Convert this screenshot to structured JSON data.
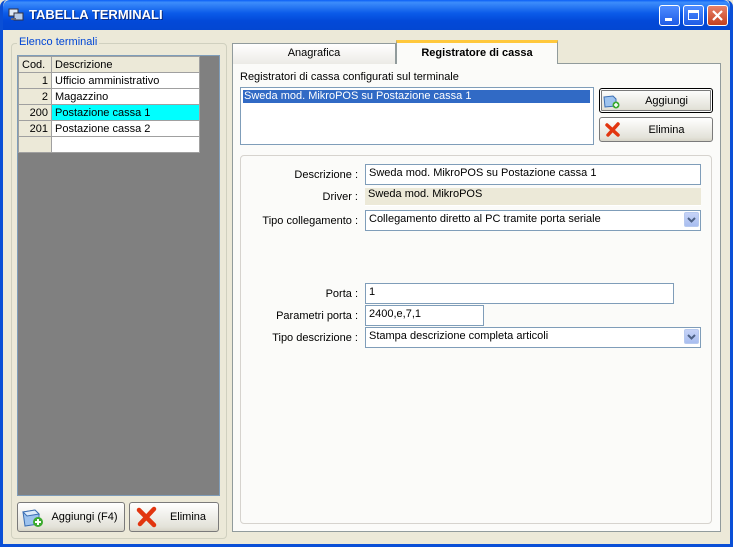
{
  "window": {
    "title": "TABELLA TERMINALI"
  },
  "left": {
    "group_label": "Elenco terminali",
    "columns": [
      "Cod.",
      "Descrizione"
    ],
    "rows": [
      {
        "code": "1",
        "desc": "Ufficio amministrativo"
      },
      {
        "code": "2",
        "desc": "Magazzino"
      },
      {
        "code": "200",
        "desc": "Postazione cassa 1"
      },
      {
        "code": "201",
        "desc": "Postazione cassa 2"
      },
      {
        "code": "",
        "desc": ""
      }
    ],
    "add_label": "Aggiungi (F4)",
    "delete_label": "Elimina"
  },
  "tabs": [
    "Anagrafica",
    "Registratore di cassa"
  ],
  "register": {
    "list_caption": "Registratori di cassa configurati sul terminale",
    "list_items": [
      "Sweda mod. MikroPOS su Postazione cassa 1"
    ],
    "add_label": "Aggiungi",
    "delete_label": "Elimina"
  },
  "form": {
    "descrizione_label": "Descrizione :",
    "descrizione_value": "Sweda mod. MikroPOS su Postazione cassa 1",
    "driver_label": "Driver :",
    "driver_value": "Sweda mod. MikroPOS",
    "tipo_collegamento_label": "Tipo collegamento :",
    "tipo_collegamento_value": "Collegamento diretto al PC tramite porta seriale",
    "porta_label": "Porta :",
    "porta_value": "1",
    "parametri_label": "Parametri porta :",
    "parametri_value": "2400,e,7,1",
    "tipo_descrizione_label": "Tipo descrizione :",
    "tipo_descrizione_value": "Stampa descrizione completa articoli"
  }
}
